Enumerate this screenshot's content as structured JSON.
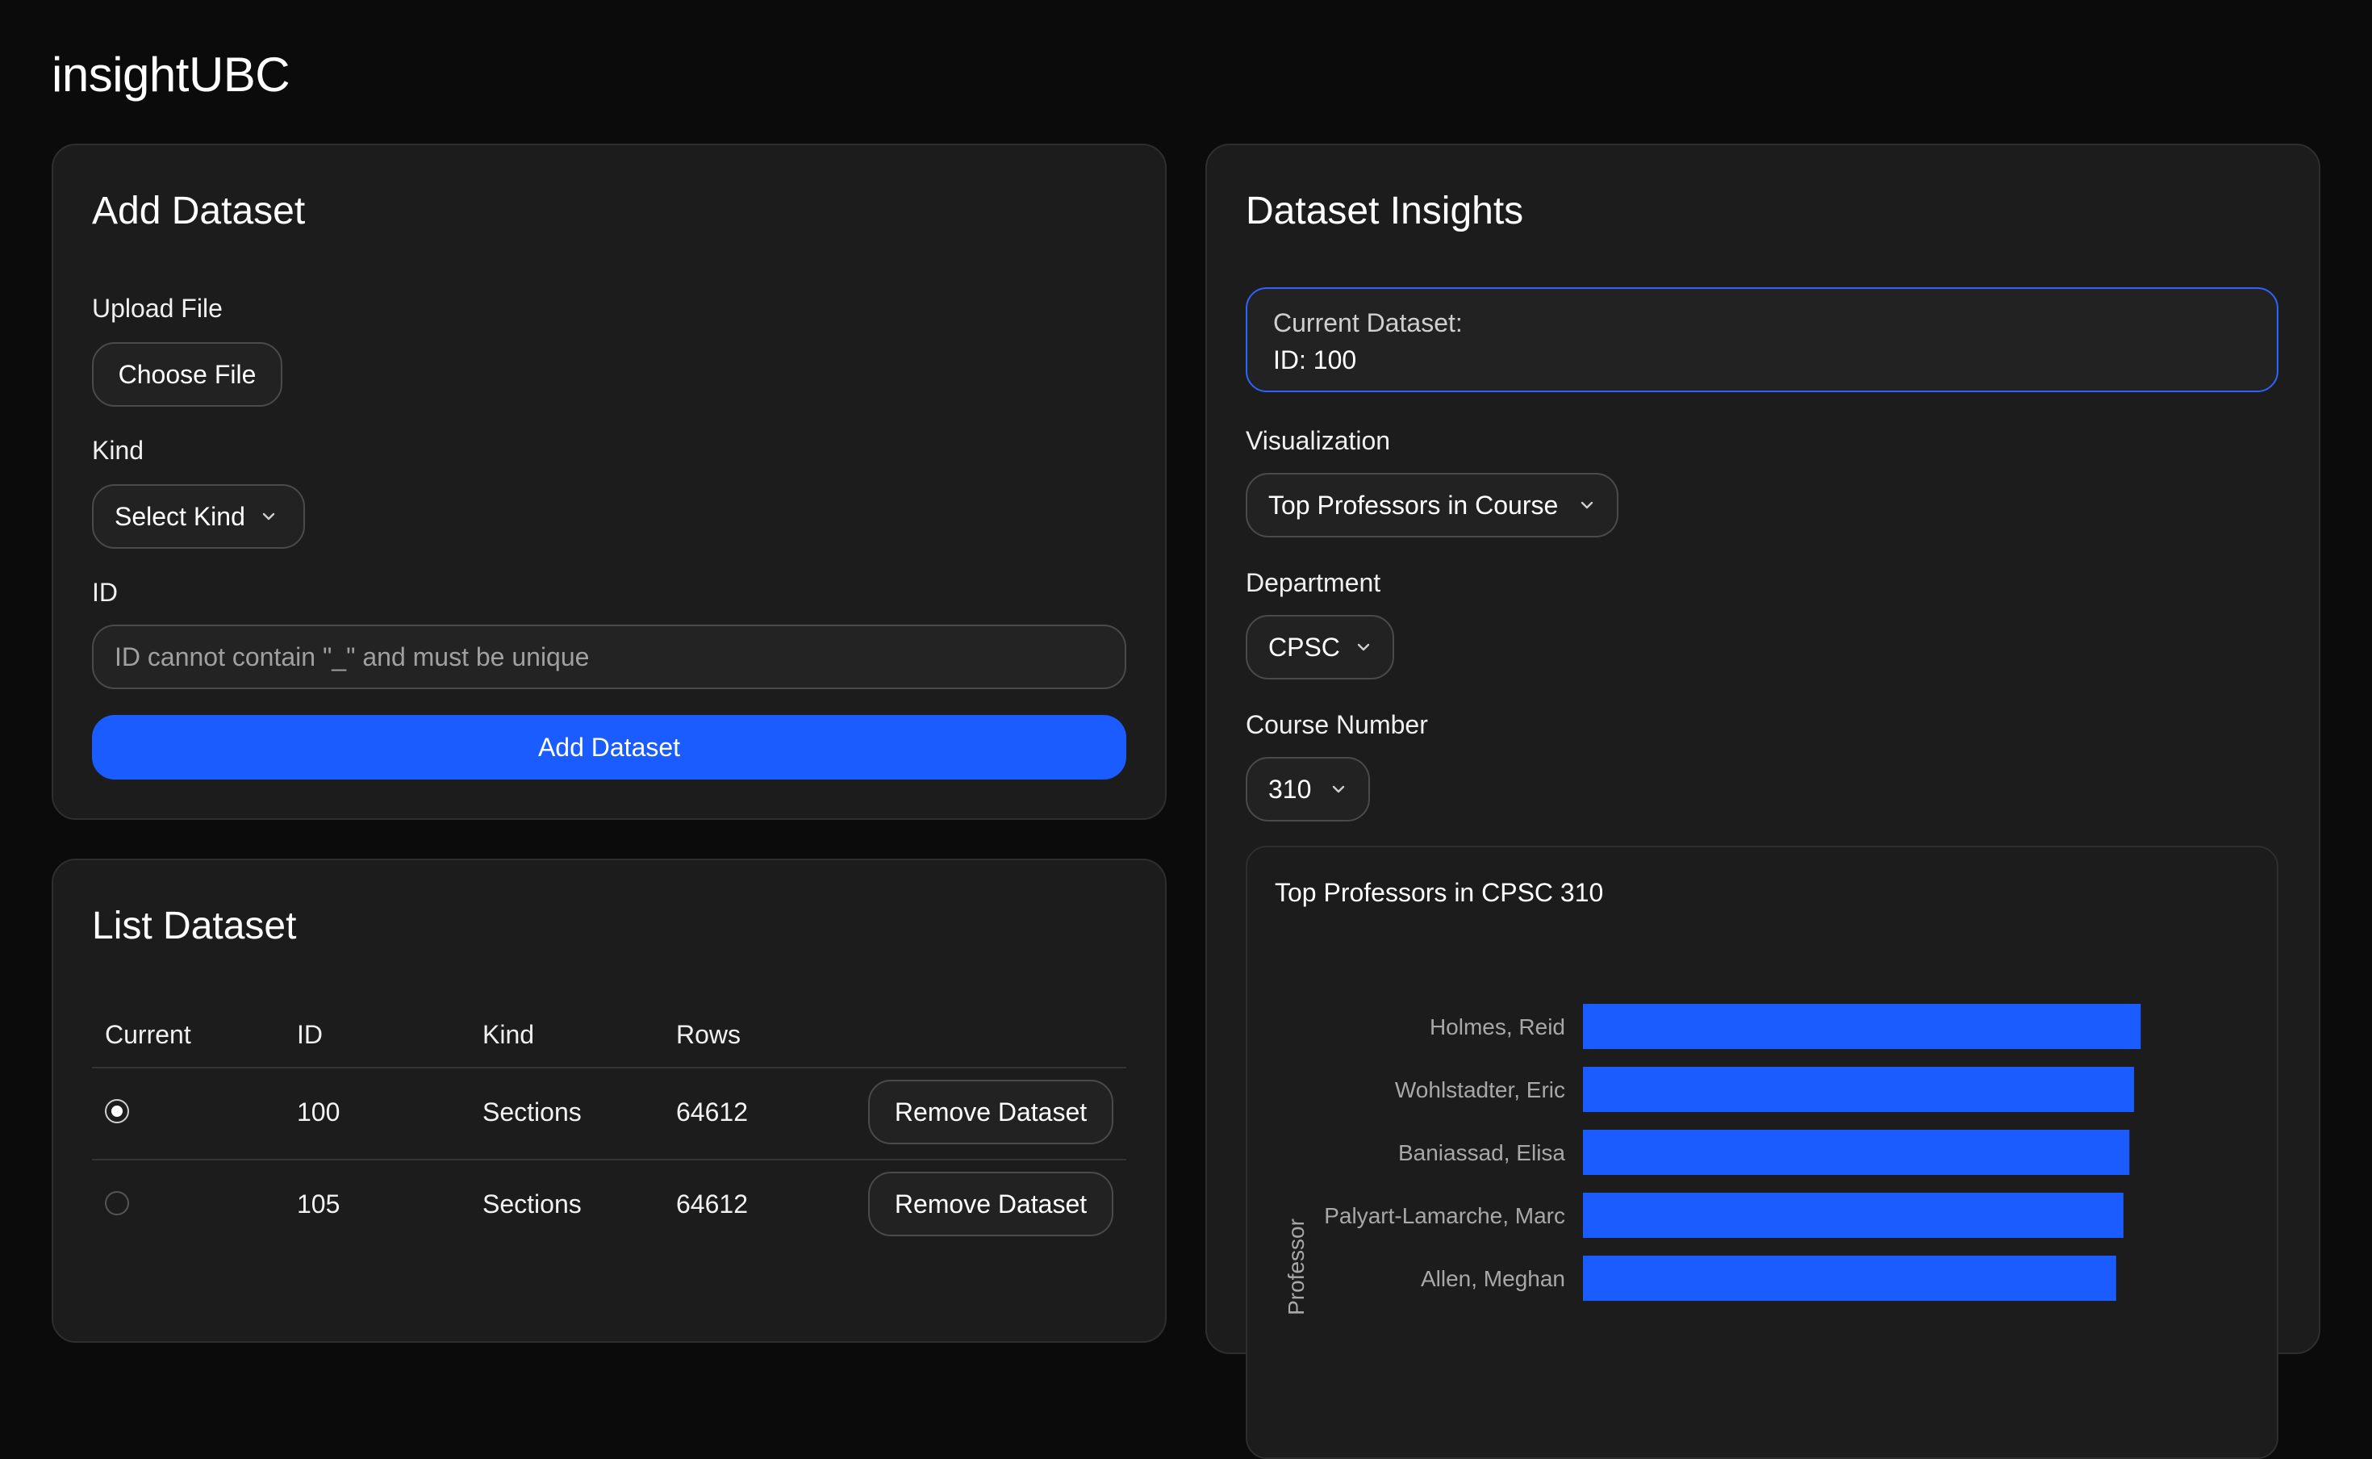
{
  "app": {
    "title": "insightUBC"
  },
  "add_dataset": {
    "title": "Add Dataset",
    "upload_label": "Upload File",
    "choose_file_label": "Choose File",
    "kind_label": "Kind",
    "kind_select": "Select Kind",
    "id_label": "ID",
    "id_placeholder": "ID cannot contain \"_\" and must be unique",
    "submit_label": "Add Dataset"
  },
  "list_dataset": {
    "title": "List Dataset",
    "columns": [
      "Current",
      "ID",
      "Kind",
      "Rows"
    ],
    "rows": [
      {
        "current": true,
        "id": "100",
        "kind": "Sections",
        "rows": "64612",
        "action": "Remove Dataset"
      },
      {
        "current": false,
        "id": "105",
        "kind": "Sections",
        "rows": "64612",
        "action": "Remove Dataset"
      }
    ]
  },
  "insights": {
    "title": "Dataset Insights",
    "current_label": "Current Dataset:",
    "current_value": "ID: 100",
    "visualization_label": "Visualization",
    "visualization_value": "Top Professors in Course",
    "department_label": "Department",
    "department_value": "CPSC",
    "course_label": "Course Number",
    "course_value": "310"
  },
  "colors": {
    "accent": "#1a5cff",
    "focus_border": "#2f63ff",
    "card_bg": "#1c1c1c",
    "page_bg": "#0b0b0b"
  },
  "chart_data": {
    "type": "bar",
    "orientation": "horizontal",
    "title": "Top Professors in CPSC 310",
    "ylabel": "Professor",
    "categories": [
      "Holmes, Reid",
      "Wohlstadter, Eric",
      "Baniassad, Elisa",
      "Palyart-Lamarche, Marc",
      "Allen, Meghan"
    ],
    "values": [
      83.9,
      82.9,
      82.2,
      81.3,
      80.2
    ],
    "xlim": [
      0,
      100
    ],
    "color": "#1a5cff",
    "legend": "none",
    "grid": false
  }
}
